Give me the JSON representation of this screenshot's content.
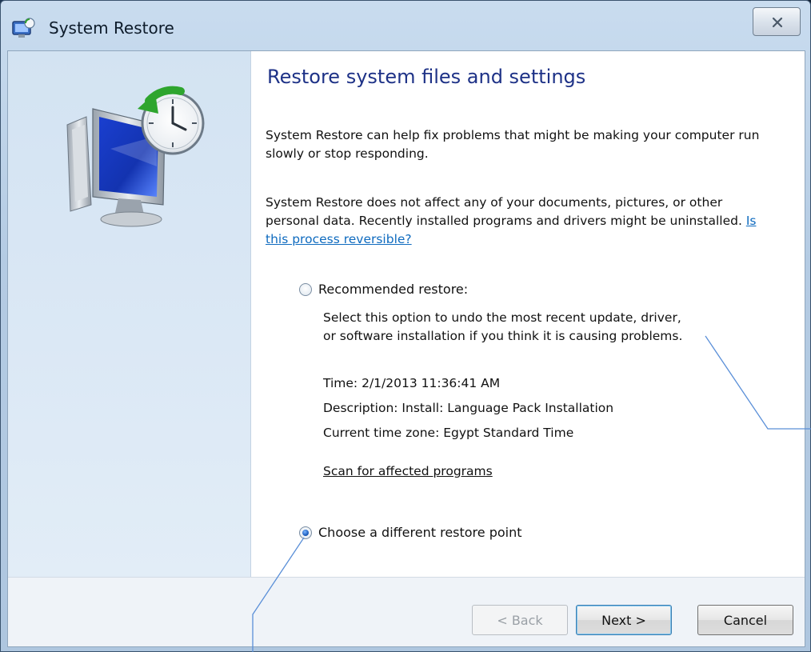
{
  "window": {
    "title": "System Restore"
  },
  "page": {
    "heading": "Restore system files and settings",
    "intro": "System Restore can help fix problems that might be making your computer run slowly or stop responding.",
    "info_before_link": "System Restore does not affect any of your documents, pictures, or other personal data. Recently installed programs and drivers might be uninstalled. ",
    "info_link": "Is this process reversible?"
  },
  "options": {
    "recommended": {
      "label": "Recommended restore:",
      "checked": false,
      "description_line1": "Select this option to undo the most recent update, driver,",
      "description_line2": "or software installation if you think it is causing problems.",
      "time": "Time: 2/1/2013 11:36:41 AM",
      "description": "Description: Install: Language Pack Installation",
      "timezone": "Current time zone: Egypt Standard Time",
      "scan_link": "Scan for affected programs"
    },
    "different": {
      "label": "Choose a different restore point",
      "checked": true
    }
  },
  "buttons": {
    "back": "< Back",
    "next": "Next >",
    "cancel": "Cancel"
  }
}
